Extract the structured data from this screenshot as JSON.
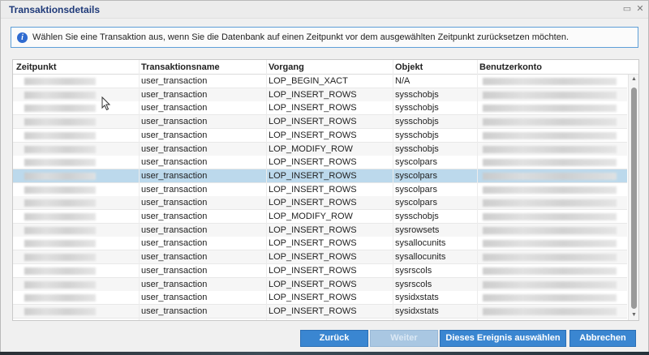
{
  "window": {
    "title": "Transaktionsdetails",
    "restore_icon": "restore-icon",
    "close_icon": "close-icon"
  },
  "info": {
    "icon": "info-icon",
    "text": "Wählen Sie eine Transaktion aus, wenn Sie die Datenbank auf einen Zeitpunkt vor dem ausgewählten Zeitpunkt zurücksetzen möchten."
  },
  "table": {
    "columns": [
      "Zeitpunkt",
      "Transaktionsname",
      "Vorgang",
      "Objekt",
      "Benutzerkonto"
    ],
    "selected_row_index": 7,
    "rows": [
      {
        "name": "user_transaction",
        "op": "LOP_BEGIN_XACT",
        "obj": "N/A"
      },
      {
        "name": "user_transaction",
        "op": "LOP_INSERT_ROWS",
        "obj": "sysschobjs"
      },
      {
        "name": "user_transaction",
        "op": "LOP_INSERT_ROWS",
        "obj": "sysschobjs"
      },
      {
        "name": "user_transaction",
        "op": "LOP_INSERT_ROWS",
        "obj": "sysschobjs"
      },
      {
        "name": "user_transaction",
        "op": "LOP_INSERT_ROWS",
        "obj": "sysschobjs"
      },
      {
        "name": "user_transaction",
        "op": "LOP_MODIFY_ROW",
        "obj": "sysschobjs"
      },
      {
        "name": "user_transaction",
        "op": "LOP_INSERT_ROWS",
        "obj": "syscolpars"
      },
      {
        "name": "user_transaction",
        "op": "LOP_INSERT_ROWS",
        "obj": "syscolpars"
      },
      {
        "name": "user_transaction",
        "op": "LOP_INSERT_ROWS",
        "obj": "syscolpars"
      },
      {
        "name": "user_transaction",
        "op": "LOP_INSERT_ROWS",
        "obj": "syscolpars"
      },
      {
        "name": "user_transaction",
        "op": "LOP_MODIFY_ROW",
        "obj": "sysschobjs"
      },
      {
        "name": "user_transaction",
        "op": "LOP_INSERT_ROWS",
        "obj": "sysrowsets"
      },
      {
        "name": "user_transaction",
        "op": "LOP_INSERT_ROWS",
        "obj": "sysallocunits"
      },
      {
        "name": "user_transaction",
        "op": "LOP_INSERT_ROWS",
        "obj": "sysallocunits"
      },
      {
        "name": "user_transaction",
        "op": "LOP_INSERT_ROWS",
        "obj": "sysrscols"
      },
      {
        "name": "user_transaction",
        "op": "LOP_INSERT_ROWS",
        "obj": "sysrscols"
      },
      {
        "name": "user_transaction",
        "op": "LOP_INSERT_ROWS",
        "obj": "sysidxstats"
      },
      {
        "name": "user_transaction",
        "op": "LOP_INSERT_ROWS",
        "obj": "sysidxstats"
      }
    ]
  },
  "buttons": {
    "back": "Zurück",
    "next": "Weiter",
    "select": "Dieses Ereignis auswählen",
    "cancel": "Abbrechen"
  },
  "colors": {
    "accent": "#3a86d1",
    "selection": "#bcd9ec",
    "title": "#1f3a79"
  }
}
